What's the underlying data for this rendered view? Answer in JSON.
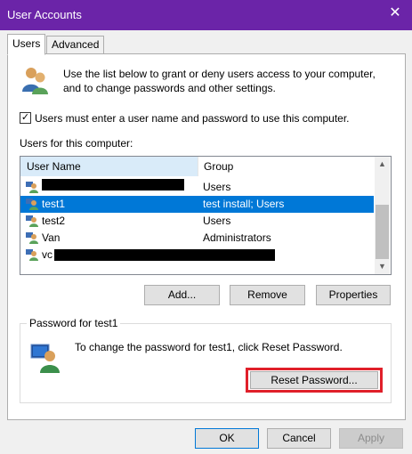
{
  "window": {
    "title": "User Accounts",
    "close_glyph": "✕"
  },
  "tabs": [
    {
      "label": "Users",
      "active": true
    },
    {
      "label": "Advanced",
      "active": false
    }
  ],
  "intro": {
    "icon": "users-icon",
    "line1": "Use the list below to grant or deny users access to your computer,",
    "line2": "and to change passwords and other settings."
  },
  "checkbox": {
    "checked": true,
    "mark": "✓",
    "label": "Users must enter a user name and password to use this computer."
  },
  "users_section_label": "Users for this computer:",
  "listview": {
    "columns": [
      "User Name",
      "Group"
    ],
    "rows": [
      {
        "name": "",
        "group": "Users",
        "redacted": true,
        "selected": false
      },
      {
        "name": "test1",
        "group": "test install; Users",
        "redacted": false,
        "selected": true
      },
      {
        "name": "test2",
        "group": "Users",
        "redacted": false,
        "selected": false
      },
      {
        "name": "Van",
        "group": "Administrators",
        "redacted": false,
        "selected": false
      },
      {
        "name": "vc",
        "group": "",
        "redacted": true,
        "selected": false
      }
    ],
    "scroll_up_glyph": "▲",
    "scroll_down_glyph": "▼"
  },
  "list_buttons": {
    "add": "Add...",
    "remove": "Remove",
    "properties": "Properties"
  },
  "password_group": {
    "title": "Password for test1",
    "text": "To change the password for test1, click Reset Password.",
    "reset_button": "Reset Password...",
    "highlight_color": "#e0202a"
  },
  "dialog_buttons": {
    "ok": "OK",
    "cancel": "Cancel",
    "apply": "Apply"
  },
  "colors": {
    "titlebar": "#6b24a8",
    "selection": "#0078d7"
  }
}
